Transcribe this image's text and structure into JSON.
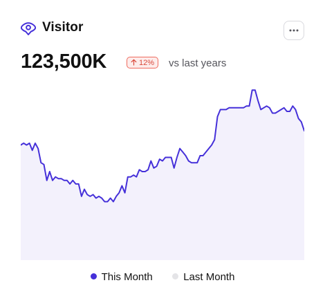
{
  "card": {
    "title": "Visitor",
    "icon": "eye-location-icon",
    "more_icon": "more-horizontal-icon"
  },
  "metric": {
    "value": "123,500K",
    "change": "12%",
    "change_direction": "up",
    "compare_label": "vs last years"
  },
  "colors": {
    "accent": "#4530d9",
    "area_fill": "#f3f1fc",
    "badge_border": "#ef6a5d",
    "badge_bg": "#fdeceb",
    "badge_text": "#d9493b",
    "last_month": "#e4e4e7"
  },
  "chart_data": {
    "type": "area",
    "title": "",
    "xlabel": "",
    "ylabel": "",
    "ylim": [
      0,
      100
    ],
    "grid": false,
    "legend_position": "bottom",
    "series": [
      {
        "name": "This Month",
        "color": "#4530d9",
        "values": [
          65,
          66,
          65,
          66,
          62,
          66,
          63,
          55,
          54,
          45,
          50,
          45,
          47,
          46,
          46,
          45,
          45,
          43,
          45,
          43,
          43,
          36,
          40,
          37,
          36,
          37,
          35,
          36,
          35,
          33,
          33,
          35,
          33,
          36,
          38,
          42,
          38,
          47,
          47,
          48,
          47,
          51,
          50,
          50,
          51,
          56,
          52,
          53,
          57,
          56,
          58,
          58,
          58,
          52,
          58,
          63,
          61,
          59,
          56,
          55,
          55,
          55,
          59,
          59,
          61,
          63,
          65,
          68,
          81,
          85,
          85,
          85,
          86,
          86,
          86,
          86,
          86,
          86,
          87,
          87,
          96,
          96,
          90,
          85,
          86,
          87,
          86,
          83,
          83,
          84,
          85,
          86,
          84,
          84,
          87,
          85,
          80,
          78,
          73
        ]
      },
      {
        "name": "Last Month",
        "color": "#e4e4e7",
        "values": []
      }
    ]
  }
}
